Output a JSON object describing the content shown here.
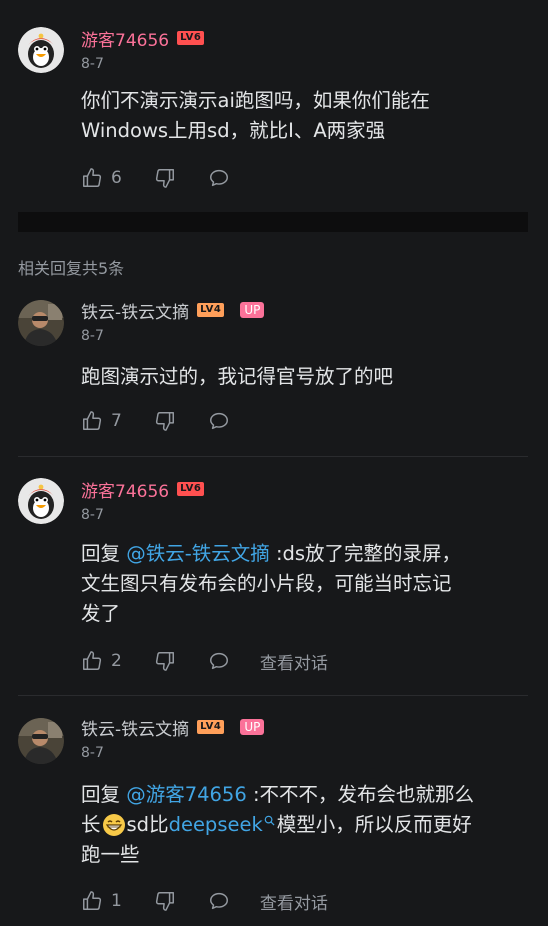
{
  "related_label": "相关回复共5条",
  "main_comment": {
    "username": "游客74656",
    "level": "LV6",
    "date": "8-7",
    "text_line1": "你们不演示演示ai跑图吗，如果你们能在",
    "text_line2": "Windows上用sd，就比I、A两家强",
    "likes": "6"
  },
  "replies": [
    {
      "username": "铁云-铁云文摘",
      "level": "LV4",
      "badge": "UP",
      "date": "8-7",
      "text": "跑图演示过的，我记得官号放了的吧",
      "likes": "7"
    },
    {
      "username": "游客74656",
      "level": "LV6",
      "date": "8-7",
      "reply_prefix": "回复 ",
      "mention": "@铁云-铁云文摘",
      "text_a": " :ds放了完整的录屏，",
      "text_b": "文生图只有发布会的小片段，可能当时忘记",
      "text_c": "发了",
      "likes": "2",
      "view_conversation": "查看对话"
    },
    {
      "username": "铁云-铁云文摘",
      "level": "LV4",
      "badge": "UP",
      "date": "8-7",
      "reply_prefix": "回复 ",
      "mention": "@游客74656",
      "text_a": " :不不不，发布会也就那么",
      "text_b1": "长",
      "text_b2": "sd比",
      "keyword": "deepseek",
      "text_b3": "模型小，所以反而更好",
      "text_c": "跑一些",
      "likes": "1",
      "view_conversation": "查看对话"
    }
  ],
  "icons": {
    "like": "thumbs-up-icon",
    "dislike": "thumbs-down-icon",
    "reply": "comment-bubble-icon",
    "search": "search-icon",
    "emoji": "grin-emoji-icon"
  },
  "colors": {
    "background": "#17181a",
    "username_pink": "#fb7299",
    "mention_blue": "#41a5e4",
    "level6": "#ff5050",
    "level4": "#ff9f5a"
  }
}
